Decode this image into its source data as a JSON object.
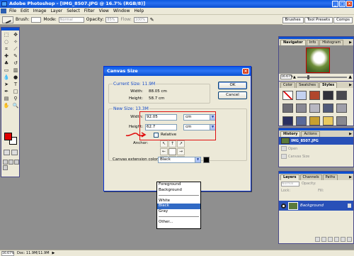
{
  "window": {
    "title": "Adobe Photoshop - [IMG_8507.JPG @ 16.7% (RGB/8)]",
    "controls": [
      "_",
      "□",
      "×"
    ]
  },
  "menu": {
    "items": [
      "File",
      "Edit",
      "Image",
      "Layer",
      "Select",
      "Filter",
      "View",
      "Window",
      "Help"
    ]
  },
  "options_bar": {
    "brush_label": "Brush:",
    "mode_label": "Mode:",
    "mode_value": "Normal",
    "opacity_label": "Opacity:",
    "opacity_value": "85%",
    "flow_label": "Flow:",
    "flow_value": "100%"
  },
  "palette_well": {
    "tabs": [
      "Brushes",
      "Tool Presets",
      "Comps"
    ]
  },
  "navigator_panel": {
    "tabs": [
      "Navigator",
      "Info",
      "Histogram"
    ],
    "zoom": "16.67%"
  },
  "styles_panel": {
    "tabs": [
      "Color",
      "Swatches",
      "Styles"
    ],
    "swatches": [
      "#ffffff",
      "#c4d2f0",
      "#b0462c",
      "#30303a",
      "#4a4a50",
      "#6e6e76",
      "#8a8a94",
      "#b8b8c2",
      "#505a7a",
      "#a0a0aa",
      "#2a3060",
      "#5a6a9a",
      "#c8a030",
      "#e8c860",
      "#888890"
    ]
  },
  "history_panel": {
    "tabs": [
      "History",
      "Actions"
    ],
    "items": [
      "IMG_8507.JPG",
      "Open",
      "Canvas Size"
    ]
  },
  "layers_panel": {
    "tabs": [
      "Layers",
      "Channels",
      "Paths"
    ],
    "blend_mode": "Normal",
    "opacity_label": "Opacity:",
    "fill_label": "Fill:",
    "lock_label": "Lock:",
    "layer_name": "Background"
  },
  "status_bar": {
    "zoom": "16.67%",
    "doc": "Doc: 11.9M/11.9M",
    "arrow": "▶"
  },
  "dialog": {
    "title": "Canvas Size",
    "current_size": {
      "legend": "Current Size: 11.9M",
      "width_label": "Width:",
      "width_value": "88.05 cm",
      "height_label": "Height:",
      "height_value": "58.7 cm"
    },
    "new_size": {
      "legend": "New Size: 13.3M",
      "width_label": "Width:",
      "width_value": "92.05",
      "width_unit": "cm",
      "height_label": "Height:",
      "height_value": "62.7",
      "height_unit": "cm",
      "relative_label": "Relative",
      "relative_checked": false,
      "anchor_label": "Anchor:",
      "anchor_arrows": [
        "↖",
        "↑",
        "↗",
        "←",
        "",
        "→",
        "↙",
        "↓",
        "↘"
      ]
    },
    "extension_label": "Canvas extension color:",
    "extension_value": "Black",
    "extension_swatch": "#000000",
    "ok_label": "OK",
    "cancel_label": "Cancel"
  },
  "extension_dropdown": {
    "options": [
      "Foreground",
      "Background",
      "",
      "White",
      "Black",
      "Gray",
      "",
      "Other..."
    ],
    "selected": "Black"
  },
  "colors": {
    "foreground": "#e00000",
    "background": "#ffffff",
    "annotation": "#e01010"
  }
}
